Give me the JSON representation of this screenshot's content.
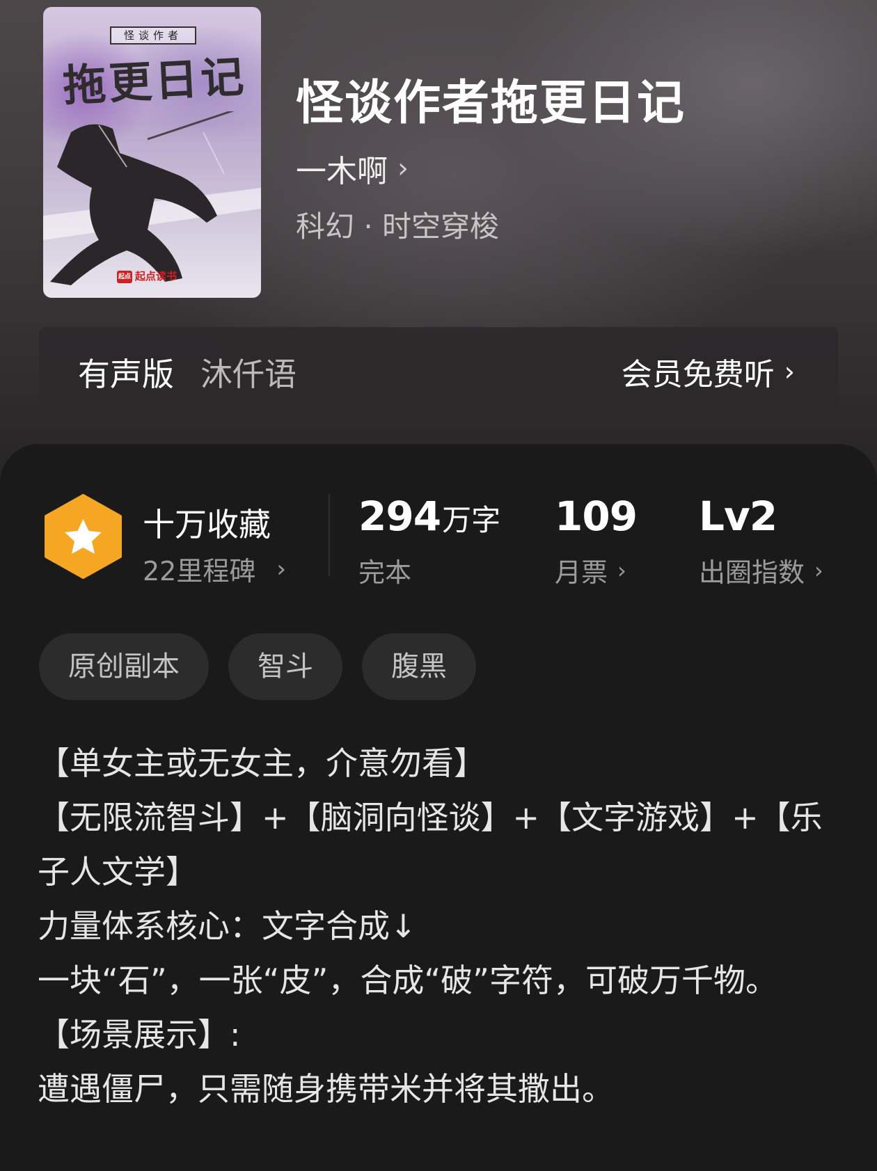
{
  "book": {
    "cover_tag": "怪谈作者",
    "cover_title": "拖更日记",
    "cover_publisher": "起点读书",
    "cover_publisher_mark": "起点",
    "title": "怪谈作者拖更日记",
    "author": "一木啊",
    "genre": "科幻 · 时空穿梭"
  },
  "audio": {
    "label": "有声版",
    "narrator": "沐仟语",
    "link": "会员免费听"
  },
  "stats": {
    "badge_icon": "star-hexagon-icon",
    "collection_title": "十万收藏",
    "milestone": "22里程碑",
    "word_count": "294",
    "word_unit": "万字",
    "status": "完本",
    "monthly_votes": "109",
    "monthly_votes_label": "月票",
    "level": "Lv2",
    "level_label": "出圈指数"
  },
  "tags": [
    "原创副本",
    "智斗",
    "腹黑"
  ],
  "description": [
    "【单女主或无女主，介意勿看】",
    "【无限流智斗】+【脑洞向怪谈】+【文字游戏】+【乐子人文学】",
    "力量体系核心：文字合成↓",
    "一块“石”，一张“皮”，合成“破”字符，可破万千物。",
    "【场景展示】:",
    "遭遇僵尸，只需随身携带米并将其撒出。"
  ],
  "colors": {
    "badge": "#f5a623",
    "card_bg": "#1a1a1a",
    "tag_bg": "#2c2c2c"
  }
}
